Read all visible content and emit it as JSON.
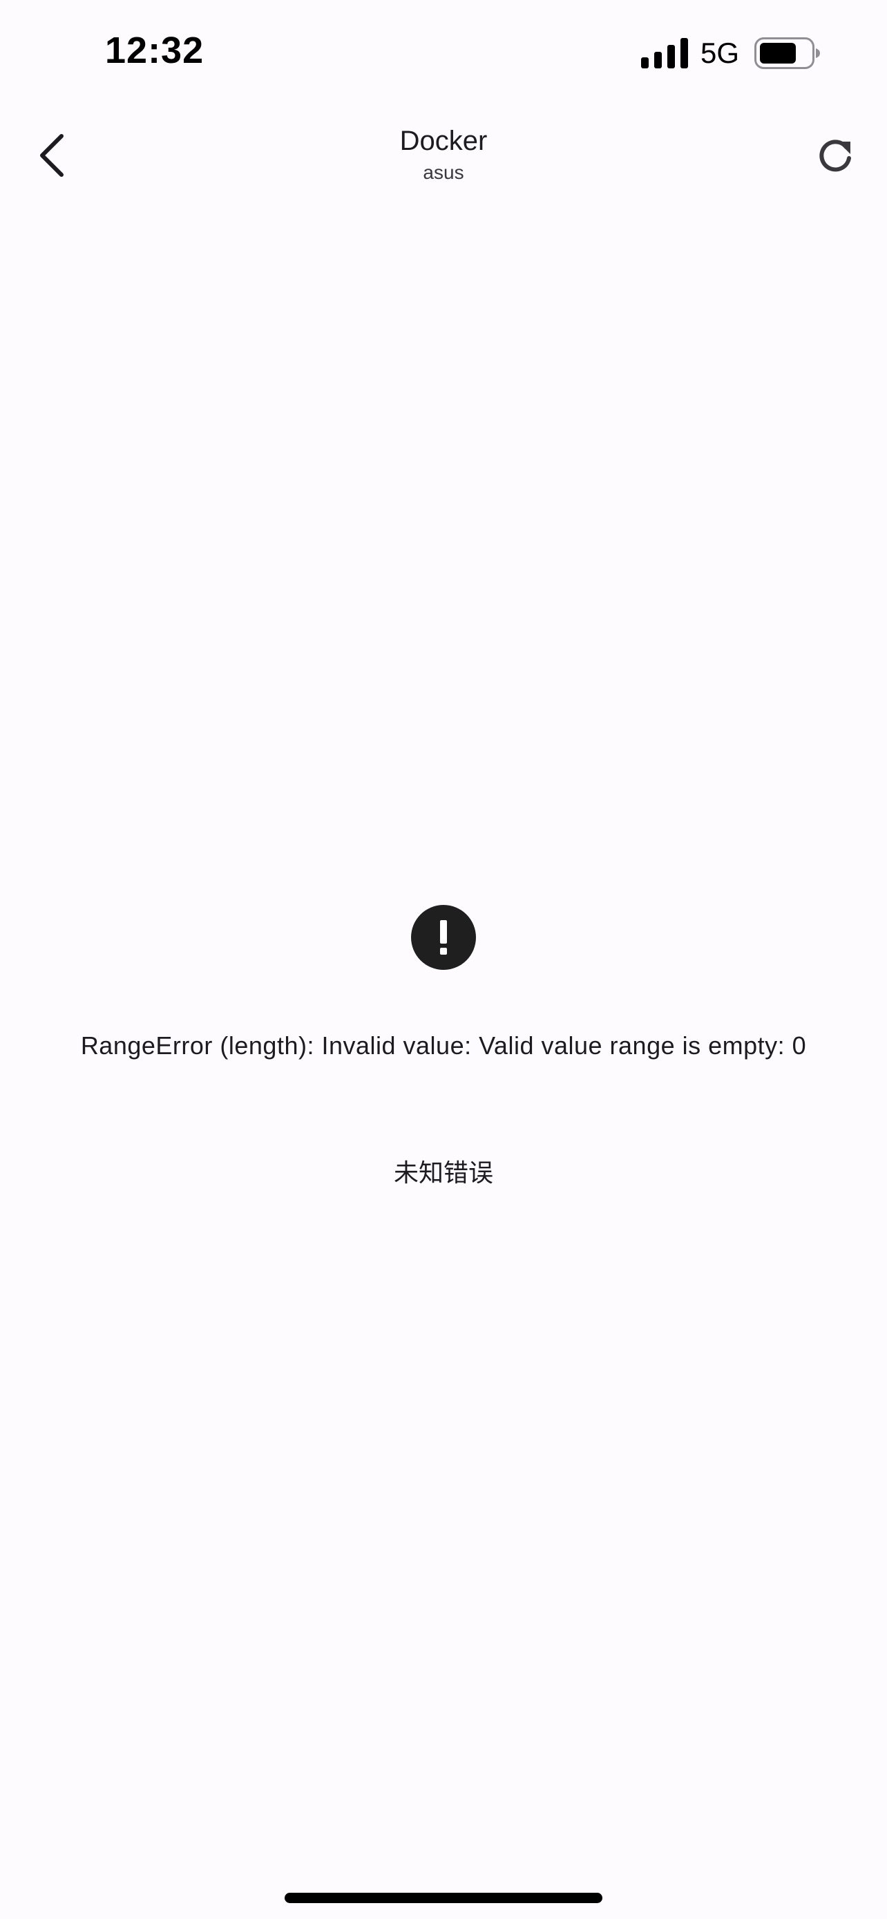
{
  "status_bar": {
    "time": "12:32",
    "network": "5G",
    "icons": [
      "signal-icon",
      "battery-icon"
    ]
  },
  "app_bar": {
    "title": "Docker",
    "subtitle": "asus",
    "icons": [
      "back-arrow-icon",
      "refresh-icon"
    ]
  },
  "error": {
    "icon": "exclamation-circle-icon",
    "message": "RangeError (length): Invalid value: Valid value range is empty: 0",
    "hint": "未知错误"
  },
  "colors": {
    "background": "#fdfbfe",
    "text": "#1c1b1f",
    "icon": "#1f1f1f"
  }
}
